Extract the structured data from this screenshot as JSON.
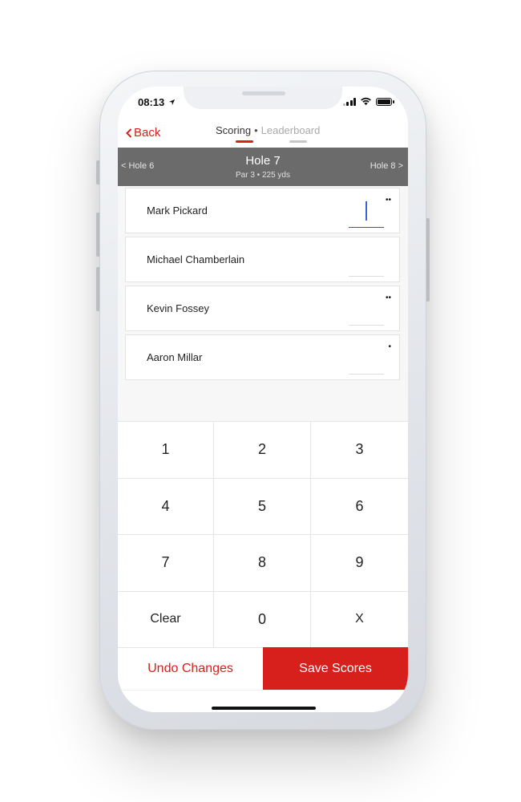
{
  "status": {
    "time": "08:13"
  },
  "nav": {
    "back_label": "Back",
    "tabs": [
      {
        "label": "Scoring",
        "active": true
      },
      {
        "label": "Leaderboard",
        "active": false
      }
    ],
    "separator": "•"
  },
  "hole": {
    "prev_label": "< Hole 6",
    "next_label": "Hole 8 >",
    "title": "Hole 7",
    "subtitle": "Par 3 • 225 yds"
  },
  "players": [
    {
      "name": "Mark Pickard",
      "score": "",
      "dots": "••",
      "active": true
    },
    {
      "name": "Michael Chamberlain",
      "score": "",
      "dots": "",
      "active": false
    },
    {
      "name": "Kevin Fossey",
      "score": "",
      "dots": "••",
      "active": false
    },
    {
      "name": "Aaron Millar",
      "score": "",
      "dots": "•",
      "active": false
    }
  ],
  "keypad": [
    "1",
    "2",
    "3",
    "4",
    "5",
    "6",
    "7",
    "8",
    "9",
    "Clear",
    "0",
    "X"
  ],
  "actions": {
    "undo_label": "Undo Changes",
    "save_label": "Save Scores"
  },
  "colors": {
    "accent": "#d71f1b",
    "hole_bar": "#6b6b6b",
    "caret": "#3b63d6"
  }
}
